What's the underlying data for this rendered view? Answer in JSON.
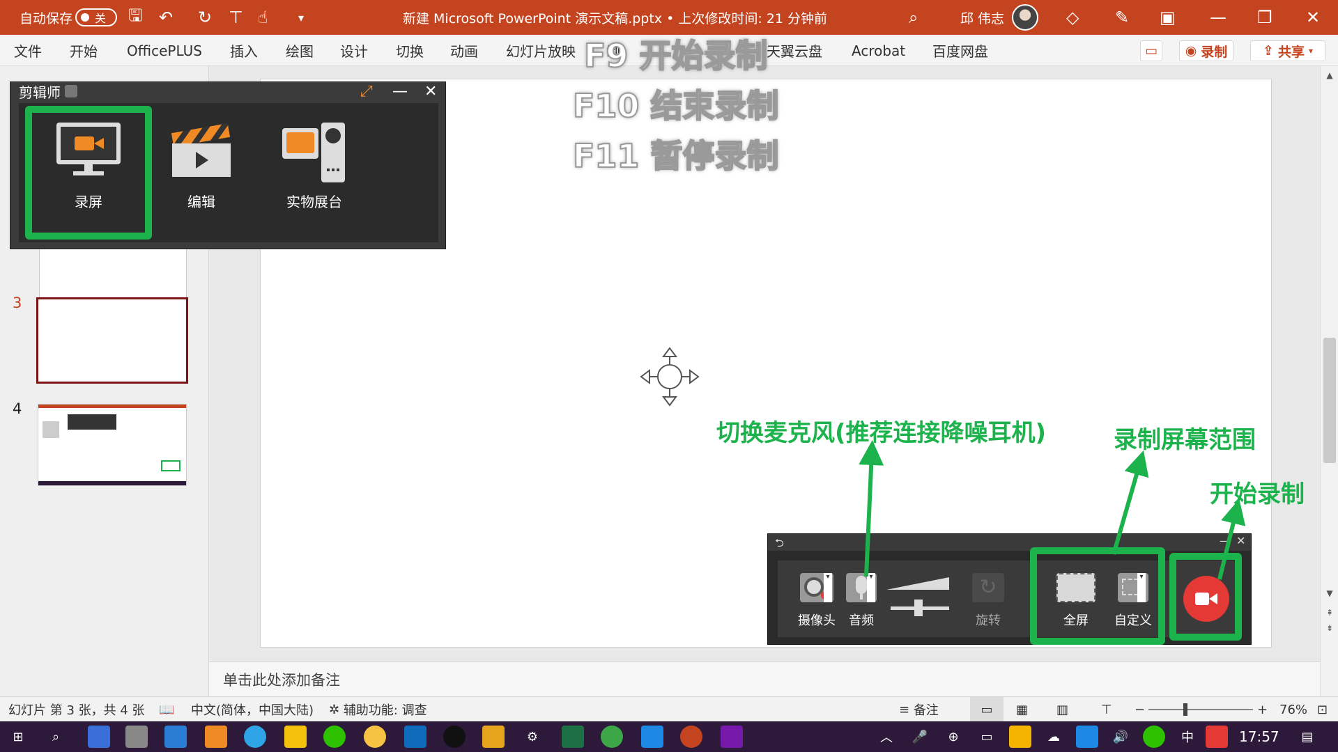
{
  "titlebar": {
    "autosave_label": "自动保存",
    "autosave_state": "关",
    "document_title": "新建 Microsoft PowerPoint 演示文稿.pptx • 上次修改时间: 21 分钟前",
    "user_name": "邱 伟志"
  },
  "ribbon": {
    "tabs": [
      "文件",
      "开始",
      "OfficePLUS",
      "插入",
      "绘图",
      "设计",
      "切换",
      "动画",
      "幻灯片放映",
      "制",
      "天翼云盘",
      "Acrobat",
      "百度网盘"
    ],
    "record_button": "录制",
    "share_button": "共享"
  },
  "hotkeys": {
    "f9": "F9 开始录制",
    "f10": "F10 结束录制",
    "f11": "F11 暂停录制"
  },
  "editor_popup": {
    "title": "剪辑师",
    "tools": [
      "录屏",
      "编辑",
      "实物展台"
    ]
  },
  "thumbnails": {
    "slide3": "3",
    "slide4": "4"
  },
  "notes_placeholder": "单击此处添加备注",
  "recorder": {
    "camera": "摄像头",
    "audio": "音频",
    "rotate": "旋转",
    "fullscreen": "全屏",
    "custom": "自定义"
  },
  "annotations": {
    "mic": "切换麦克风(推荐连接降噪耳机)",
    "range": "录制屏幕范围",
    "start": "开始录制"
  },
  "statusbar": {
    "slide_info": "幻灯片 第 3 张，共 4 张",
    "language": "中文(简体，中国大陆)",
    "accessibility": "辅助功能: 调查",
    "notes": "备注",
    "zoom": "76%"
  },
  "taskbar": {
    "ime": "中",
    "time": "17:57"
  },
  "colors": {
    "title_bar": "#c4441f",
    "annotation_green": "#1db34c",
    "record_red": "#e53935",
    "editor_orange": "#f08a24"
  }
}
